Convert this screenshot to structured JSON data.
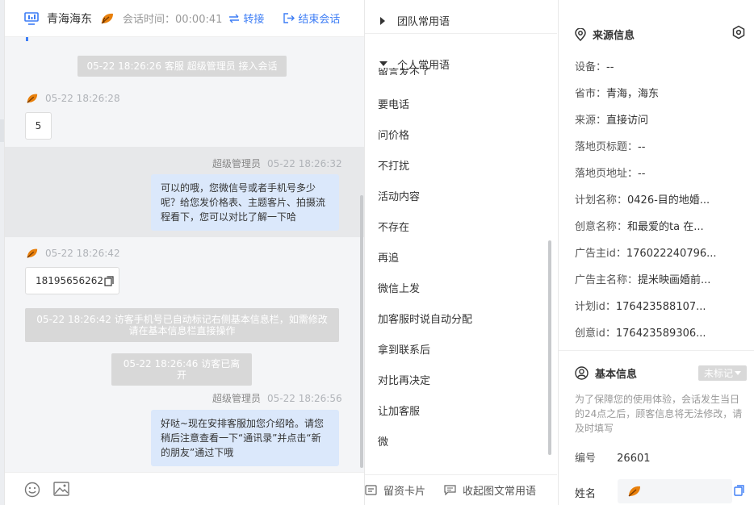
{
  "chat": {
    "header": {
      "city": "青海海东",
      "timer": "会话时间：00:00:41",
      "transfer_label": "转接",
      "end_label": "结束会话"
    },
    "messages": {
      "sys1": "05-22 18:26:26 客服 超级管理员 接入会话",
      "visitor1_time": "05-22 18:26:28",
      "visitor1_text": "5",
      "agent1_name": "超级管理员",
      "agent1_time": "05-22 18:26:32",
      "agent1_text": "可以的哦，您微信号或者手机号多少呢？给您发价格表、主题客片、拍摄流程看下，您可以对比了解一下哈",
      "visitor2_time": "05-22 18:26:42",
      "visitor2_text": "18195656262",
      "sys2": "05-22 18:26:42 访客手机号已自动标记右侧基本信息栏，如需修改请在基本信息栏直接操作",
      "sys3": "05-22 18:26:46 访客已离开",
      "agent2_name": "超级管理员",
      "agent2_time": "05-22 18:26:56",
      "agent2_text": "好哒~现在安排客服加您介绍哈。请您稍后注意查看一下“通讯录”并点击“新的朋友”通过下哦"
    }
  },
  "phrases": {
    "team_title": "团队常用语",
    "personal_title": "个人常用语",
    "partial_item": "留言发不了",
    "items": [
      "要电话",
      "问价格",
      "不打扰",
      "活动内容",
      "不存在",
      "再追",
      "微信上发",
      "加客服时说自动分配",
      "拿到联系后",
      "对比再决定",
      "让加客服",
      "微"
    ],
    "footer_card": "留资卡片",
    "footer_collapse": "收起图文常用语"
  },
  "source_info": {
    "title": "来源信息",
    "rows": [
      {
        "label": "设备：",
        "value": "--"
      },
      {
        "label": "省市：",
        "value": "青海，海东"
      },
      {
        "label": "来源：",
        "value": "直接访问"
      },
      {
        "label": "落地页标题：",
        "value": "--"
      },
      {
        "label": "落地页地址：",
        "value": "--"
      },
      {
        "label": "计划名称：",
        "value": "0426-目的地婚..."
      },
      {
        "label": "创意名称：",
        "value": "和最爱的ta 在..."
      },
      {
        "label": "广告主id：",
        "value": "176022240796..."
      },
      {
        "label": "广告主名称：",
        "value": "提米映画婚前..."
      },
      {
        "label": "计划id：",
        "value": "176423588107..."
      },
      {
        "label": "创意id：",
        "value": "176423589306..."
      }
    ]
  },
  "basic_info": {
    "title": "基本信息",
    "badge": "未标记",
    "note": "为了保障您的使用体验，会话发生当日的24点之后，顾客信息将无法修改，请及时填写",
    "id_label": "编号",
    "id_value": "26601",
    "name_label": "姓名"
  },
  "colors": {
    "accent": "#3d7df5",
    "bubble_agent": "#dbe8fb",
    "sys_msg": "#d8d8d8",
    "leaf_orange": "#e8800c"
  }
}
